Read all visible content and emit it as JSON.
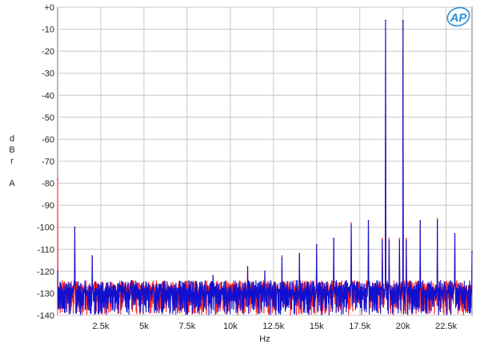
{
  "chart_data": {
    "type": "line",
    "xlabel": "Hz",
    "ylabel_lines": [
      "d",
      "B",
      "r",
      "",
      "A"
    ],
    "xlim": [
      0,
      24000
    ],
    "ylim": [
      -140,
      0
    ],
    "x_ticks": [
      {
        "value": 2500,
        "label": "2.5k"
      },
      {
        "value": 5000,
        "label": "5k"
      },
      {
        "value": 7500,
        "label": "7.5k"
      },
      {
        "value": 10000,
        "label": "10k"
      },
      {
        "value": 12500,
        "label": "12.5k"
      },
      {
        "value": 15000,
        "label": "15k"
      },
      {
        "value": 17500,
        "label": "17.5k"
      },
      {
        "value": 20000,
        "label": "20k"
      },
      {
        "value": 22500,
        "label": "22.5k"
      }
    ],
    "y_ticks": [
      {
        "value": 0,
        "label": "+0"
      },
      {
        "value": -10,
        "label": "-10"
      },
      {
        "value": -20,
        "label": "-20"
      },
      {
        "value": -30,
        "label": "-30"
      },
      {
        "value": -40,
        "label": "-40"
      },
      {
        "value": -50,
        "label": "-50"
      },
      {
        "value": -60,
        "label": "-60"
      },
      {
        "value": -70,
        "label": "-70"
      },
      {
        "value": -80,
        "label": "-80"
      },
      {
        "value": -90,
        "label": "-90"
      },
      {
        "value": -100,
        "label": "-100"
      },
      {
        "value": -110,
        "label": "-110"
      },
      {
        "value": -120,
        "label": "-120"
      },
      {
        "value": -130,
        "label": "-130"
      },
      {
        "value": -140,
        "label": "-140"
      }
    ],
    "grid": true,
    "noise_floor_db": -128,
    "series": [
      {
        "color": "#ff2020",
        "peaks": [
          {
            "x": 0,
            "y": -78
          },
          {
            "x": 1000,
            "y": -100
          },
          {
            "x": 2000,
            "y": -113
          },
          {
            "x": 9000,
            "y": -122
          },
          {
            "x": 11000,
            "y": -118
          },
          {
            "x": 12000,
            "y": -120
          },
          {
            "x": 13000,
            "y": -113
          },
          {
            "x": 14000,
            "y": -112
          },
          {
            "x": 15000,
            "y": -108
          },
          {
            "x": 16000,
            "y": -105
          },
          {
            "x": 17000,
            "y": -98
          },
          {
            "x": 18000,
            "y": -97
          },
          {
            "x": 18800,
            "y": -105
          },
          {
            "x": 19000,
            "y": -6
          },
          {
            "x": 19200,
            "y": -105
          },
          {
            "x": 19800,
            "y": -105
          },
          {
            "x": 20000,
            "y": -6
          },
          {
            "x": 20200,
            "y": -105
          },
          {
            "x": 21000,
            "y": -97
          },
          {
            "x": 22000,
            "y": -96
          },
          {
            "x": 23000,
            "y": -103
          },
          {
            "x": 24000,
            "y": -111
          }
        ]
      },
      {
        "color": "#1010d0",
        "peaks": [
          {
            "x": 0,
            "y": -120
          },
          {
            "x": 1000,
            "y": -100
          },
          {
            "x": 2000,
            "y": -113
          },
          {
            "x": 9000,
            "y": -122
          },
          {
            "x": 11000,
            "y": -118
          },
          {
            "x": 12000,
            "y": -120
          },
          {
            "x": 13000,
            "y": -114
          },
          {
            "x": 14000,
            "y": -112
          },
          {
            "x": 15000,
            "y": -108
          },
          {
            "x": 16000,
            "y": -105
          },
          {
            "x": 17000,
            "y": -99
          },
          {
            "x": 18000,
            "y": -97
          },
          {
            "x": 18800,
            "y": -106
          },
          {
            "x": 19000,
            "y": -6
          },
          {
            "x": 19200,
            "y": -106
          },
          {
            "x": 19800,
            "y": -106
          },
          {
            "x": 20000,
            "y": -6
          },
          {
            "x": 20200,
            "y": -106
          },
          {
            "x": 21000,
            "y": -97
          },
          {
            "x": 22000,
            "y": -97
          },
          {
            "x": 23000,
            "y": -103
          },
          {
            "x": 24000,
            "y": -111
          }
        ]
      }
    ]
  },
  "logo": {
    "text": "AP",
    "color": "#2a8fd6"
  }
}
